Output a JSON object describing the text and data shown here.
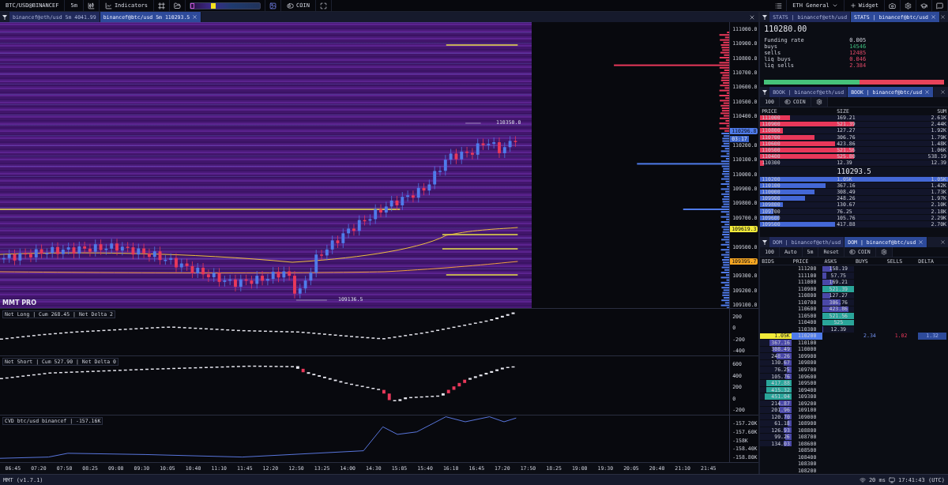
{
  "toolbar": {
    "symbol": "BTC/USD@BINANCEF",
    "timeframe": "5m",
    "indicators": "Indicators",
    "heatmap_range": {
      "level": 0.3
    },
    "coin": "COIN",
    "layout": "ETH General",
    "widget": "Widget"
  },
  "chart_tabs": [
    {
      "label": "binancef@eth/usd 5m 4041.99",
      "selected": false
    },
    {
      "label": "binancef@btc/usd 5m 110293.5",
      "selected": true
    }
  ],
  "main_chart": {
    "price_axis": [
      "111000.0",
      "110900.0",
      "110800.0",
      "110700.0",
      "110600.0",
      "110500.0",
      "110400.0",
      "110200.0",
      "110100.0",
      "110000.0",
      "109900.0",
      "109800.0",
      "109700.0",
      "109500.0",
      "109300.0",
      "109200.0",
      "109100.0"
    ],
    "markers": [
      {
        "label": "110296.8",
        "timer": "03:17",
        "color": "#4f7bea"
      },
      {
        "label": "109619.3",
        "color": "#f2ea3a"
      },
      {
        "label": "109395.7",
        "color": "#f5a623"
      }
    ],
    "high_label": "110350.0",
    "low_label": "109136.5",
    "brand": "MMT PRO"
  },
  "net_long": {
    "title": "Net Long | Cum 268.45 | Net Delta 2",
    "axis": [
      "200",
      "0",
      "-200",
      "-400"
    ]
  },
  "net_short": {
    "title": "Net Short | Cum 527.90 | Net Delta 0",
    "axis": [
      "600",
      "400",
      "200",
      "0",
      "-200"
    ]
  },
  "cvd": {
    "title": "CVD btc/usd binancef | -157.16K",
    "axis": [
      "-157.20K",
      "-157.60K",
      "-158K",
      "-158.40K",
      "-158.80K"
    ]
  },
  "time_axis": [
    "06:45",
    "07:20",
    "07:50",
    "08:25",
    "09:00",
    "09:30",
    "10:05",
    "10:40",
    "11:10",
    "11:45",
    "12:20",
    "12:50",
    "13:25",
    "14:00",
    "14:30",
    "15:05",
    "15:40",
    "16:10",
    "16:45",
    "17:20",
    "17:50",
    "18:25",
    "19:00",
    "19:30",
    "20:05",
    "20:40",
    "21:10",
    "21:45"
  ],
  "stats": {
    "tabs": [
      {
        "label": "STATS | binancef@eth/usd",
        "selected": false
      },
      {
        "label": "STATS | binancef@btc/usd",
        "selected": true
      }
    ],
    "price": "110280.00",
    "rows": [
      {
        "label": "Funding rate",
        "value": "0.005",
        "kind": "neutral"
      },
      {
        "label": "buys",
        "value": "14546",
        "kind": "buy"
      },
      {
        "label": "sells",
        "value": "12485",
        "kind": "sell"
      },
      {
        "label": "liq buys",
        "value": "0.046",
        "kind": "sell"
      },
      {
        "label": "liq sells",
        "value": "2.384",
        "kind": "sell"
      }
    ],
    "balance": {
      "level": 0.53
    }
  },
  "book": {
    "tabs": [
      {
        "label": "BOOK | binancef@eth/usd",
        "selected": false
      },
      {
        "label": "BOOK | binancef@btc/usd",
        "selected": true
      }
    ],
    "tools": [
      {
        "label": "100",
        "kind": "text"
      },
      {
        "label": "COIN",
        "kind": "toggle"
      }
    ],
    "columns": [
      "PRICE",
      "SIZE",
      "SUM"
    ],
    "asks": [
      {
        "price": "111000",
        "size": "169.21",
        "sum": "2.61K",
        "level": 0.16
      },
      {
        "price": "110900",
        "size": "521.39",
        "sum": "2.44K",
        "level": 0.5
      },
      {
        "price": "110800",
        "size": "127.27",
        "sum": "1.92K",
        "level": 0.12
      },
      {
        "price": "110700",
        "size": "306.76",
        "sum": "1.79K",
        "level": 0.29
      },
      {
        "price": "110600",
        "size": "423.86",
        "sum": "1.48K",
        "level": 0.4
      },
      {
        "price": "110500",
        "size": "521.56",
        "sum": "1.06K",
        "level": 0.5
      },
      {
        "price": "110400",
        "size": "525.80",
        "sum": "538.19",
        "level": 0.5
      },
      {
        "price": "110300",
        "size": "12.39",
        "sum": "12.39",
        "level": 0.02
      }
    ],
    "mid": "110293.5",
    "bids": [
      {
        "price": "110200",
        "size": "1.05K",
        "sum": "1.05K",
        "level": 1
      },
      {
        "price": "110100",
        "size": "367.16",
        "sum": "1.42K",
        "level": 0.35
      },
      {
        "price": "110000",
        "size": "308.49",
        "sum": "1.73K",
        "level": 0.29
      },
      {
        "price": "109900",
        "size": "248.26",
        "sum": "1.97K",
        "level": 0.24
      },
      {
        "price": "109800",
        "size": "130.67",
        "sum": "2.10K",
        "level": 0.12
      },
      {
        "price": "109700",
        "size": "76.25",
        "sum": "2.18K",
        "level": 0.07
      },
      {
        "price": "109600",
        "size": "105.76",
        "sum": "2.29K",
        "level": 0.1
      },
      {
        "price": "109500",
        "size": "417.88",
        "sum": "2.70K",
        "level": 0.4
      }
    ]
  },
  "dom": {
    "tabs": [
      {
        "label": "DOM | binancef@eth/usd",
        "selected": false
      },
      {
        "label": "DOM | binancef@btc/usd",
        "selected": true
      }
    ],
    "tools": [
      {
        "label": "100",
        "kind": "text"
      },
      {
        "label": "Auto",
        "kind": "text"
      },
      {
        "label": "5m",
        "kind": "text"
      },
      {
        "label": "Reset",
        "kind": "text"
      },
      {
        "label": "COIN",
        "kind": "toggle"
      }
    ],
    "columns": [
      "BIDS",
      "PRICE",
      "ASKS",
      "BUYS",
      "SELLS",
      "DELTA"
    ],
    "rows": [
      {
        "price": "111200",
        "ask": {
          "text": "158.19",
          "level": 0.3
        },
        "current": false
      },
      {
        "price": "111100",
        "ask": {
          "text": "57.75",
          "level": 0.11
        },
        "current": false
      },
      {
        "price": "111000",
        "ask": {
          "text": "169.21",
          "level": 0.32
        },
        "current": false
      },
      {
        "price": "110900",
        "ask": {
          "text": "521.39",
          "level": 1
        },
        "current": false
      },
      {
        "price": "110800",
        "ask": {
          "text": "127.27",
          "level": 0.24
        },
        "current": false
      },
      {
        "price": "110700",
        "ask": {
          "text": "306.76",
          "level": 0.58
        },
        "current": false
      },
      {
        "price": "110600",
        "ask": {
          "text": "423.86",
          "level": 0.81
        },
        "current": false
      },
      {
        "price": "110500",
        "ask": {
          "text": "521.56",
          "level": 1
        },
        "current": false
      },
      {
        "price": "110400",
        "ask": {
          "text": "525",
          "level": 1
        },
        "current": false
      },
      {
        "price": "110300",
        "ask": {
          "text": "12.39",
          "level": 0.02
        },
        "current": false
      },
      {
        "price": "110200",
        "bid": {
          "text": "1.05K",
          "level": 1
        },
        "buys": "2.34",
        "sells": "1.02",
        "delta": "1.32",
        "current": true
      },
      {
        "price": "110100",
        "bid": {
          "text": "367.16",
          "level": 0.7
        },
        "current": false
      },
      {
        "price": "110000",
        "bid": {
          "text": "308.49",
          "level": 0.6
        },
        "current": false
      },
      {
        "price": "109900",
        "bid": {
          "text": "248.26",
          "level": 0.47
        },
        "current": false
      },
      {
        "price": "109800",
        "bid": {
          "text": "130.67",
          "level": 0.25
        },
        "current": false
      },
      {
        "price": "109700",
        "bid": {
          "text": "76.25",
          "level": 0.15
        },
        "current": false
      },
      {
        "price": "109600",
        "bid": {
          "text": "105.76",
          "level": 0.2
        },
        "current": false
      },
      {
        "price": "109500",
        "bid": {
          "text": "417.88",
          "level": 0.8
        },
        "current": false
      },
      {
        "price": "109400",
        "bid": {
          "text": "415.32",
          "level": 0.8
        },
        "current": false
      },
      {
        "price": "109300",
        "bid": {
          "text": "451.04",
          "level": 0.86
        },
        "current": false
      },
      {
        "price": "109200",
        "bid": {
          "text": "214.87",
          "level": 0.41
        },
        "current": false
      },
      {
        "price": "109100",
        "bid": {
          "text": "201.96",
          "level": 0.38
        },
        "current": false
      },
      {
        "price": "109000",
        "bid": {
          "text": "120.70",
          "level": 0.23
        },
        "current": false
      },
      {
        "price": "108900",
        "bid": {
          "text": "61.18",
          "level": 0.12
        },
        "current": false
      },
      {
        "price": "108800",
        "bid": {
          "text": "126.93",
          "level": 0.24
        },
        "current": false
      },
      {
        "price": "108700",
        "bid": {
          "text": "99.26",
          "level": 0.19
        },
        "current": false
      },
      {
        "price": "108600",
        "bid": {
          "text": "134.03",
          "level": 0.26
        },
        "current": false
      },
      {
        "price": "108500",
        "current": false
      },
      {
        "price": "108400",
        "current": false
      },
      {
        "price": "108300",
        "current": false
      },
      {
        "price": "108200",
        "current": false
      }
    ]
  },
  "status_bar": {
    "version": "MMT (v1.7.1)",
    "latency": "20 ms",
    "clock": "17:41:43 (UTC)"
  }
}
